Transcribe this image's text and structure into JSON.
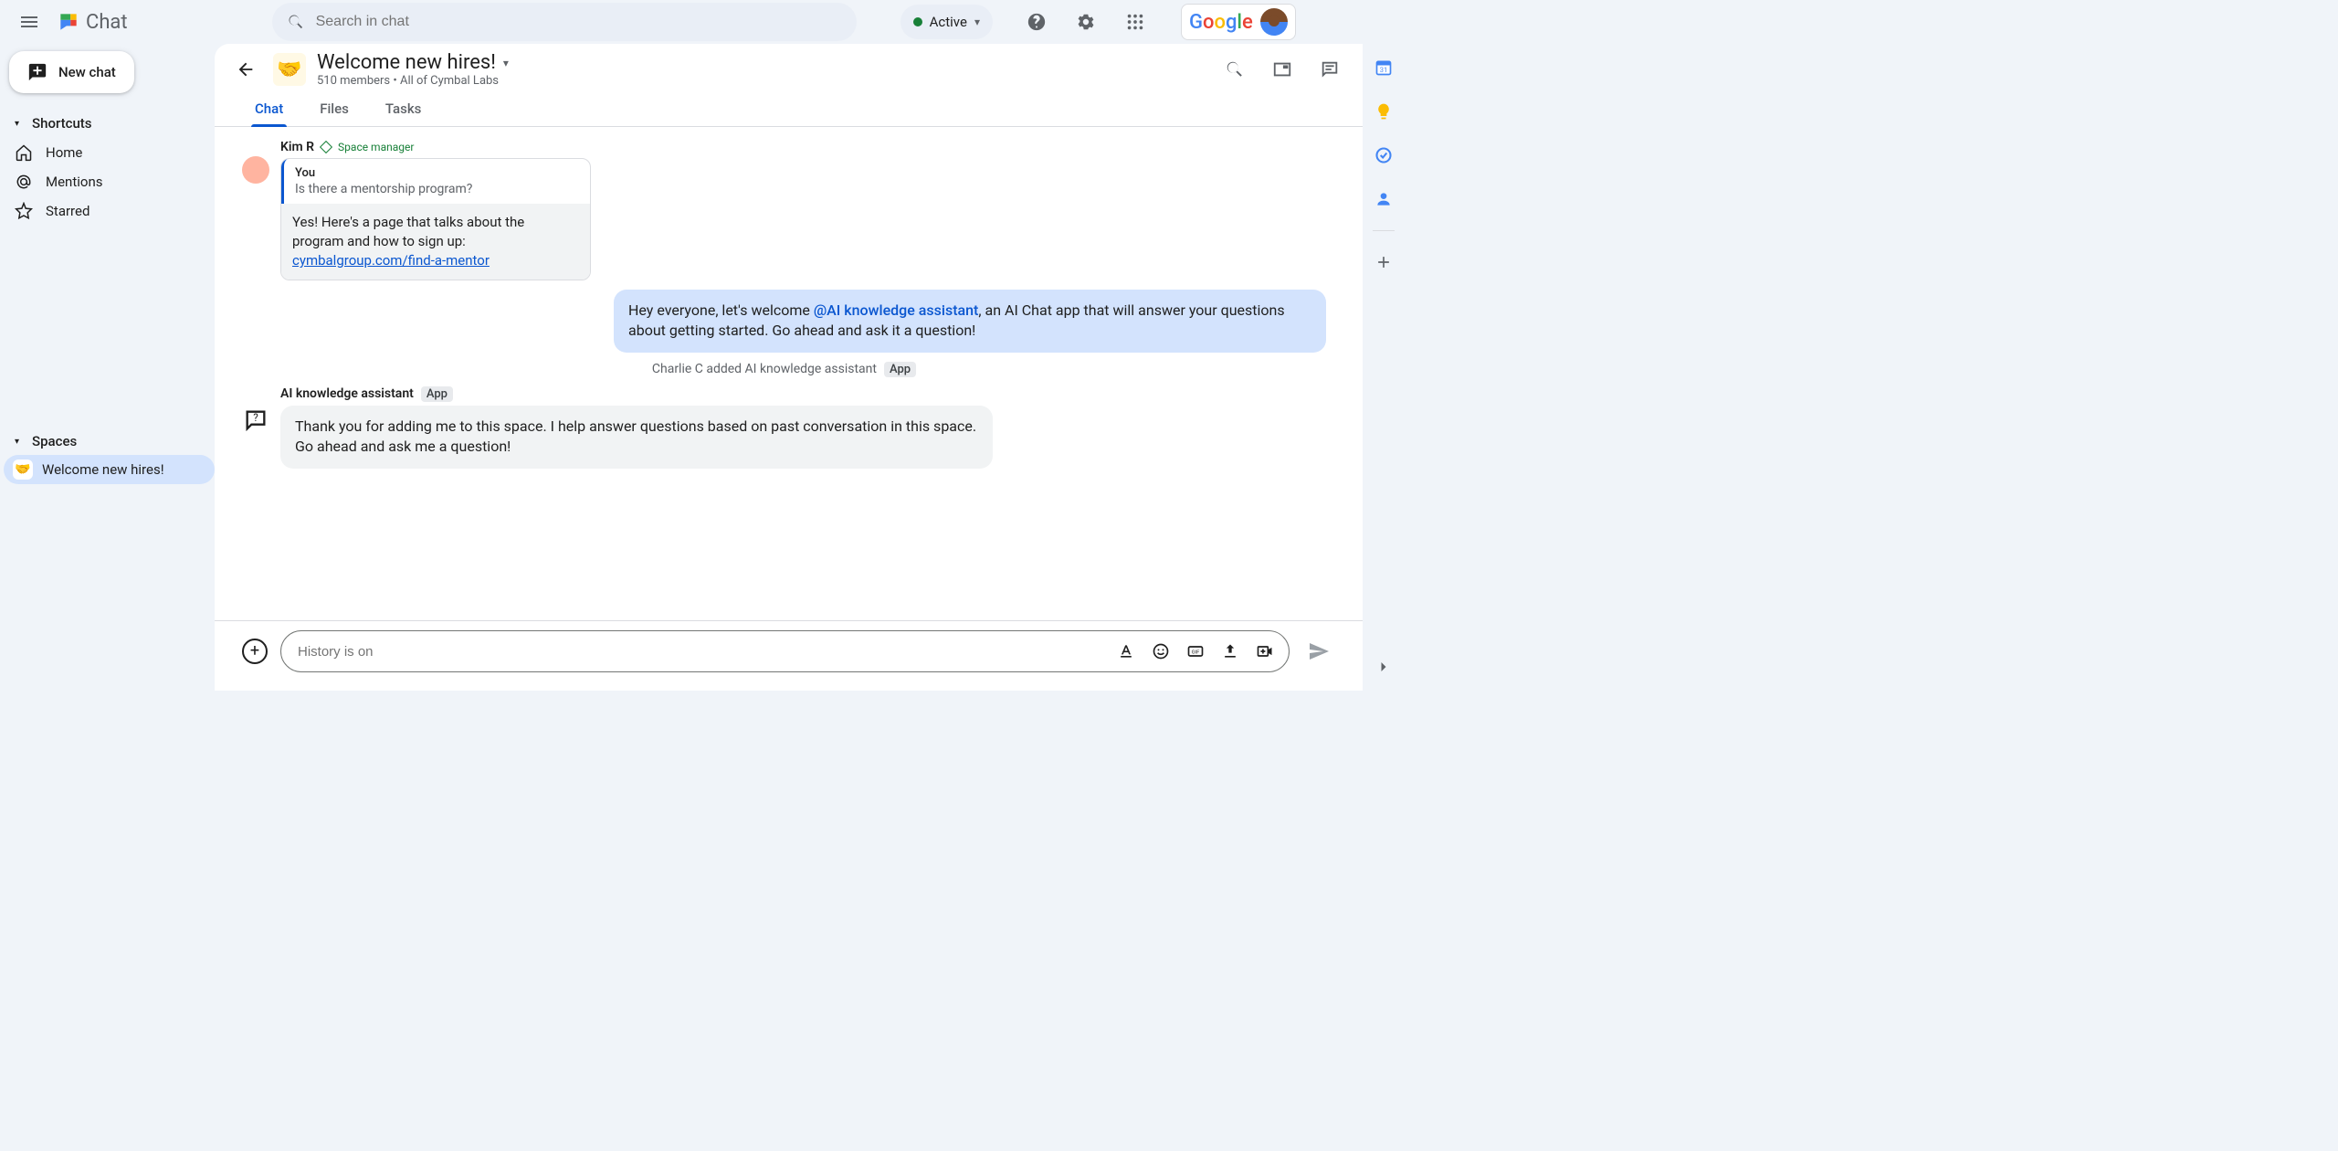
{
  "app_name": "Chat",
  "search": {
    "placeholder": "Search in chat"
  },
  "status": {
    "text": "Active"
  },
  "new_chat_label": "New chat",
  "nav": {
    "shortcuts_label": "Shortcuts",
    "items": [
      {
        "label": "Home"
      },
      {
        "label": "Mentions"
      },
      {
        "label": "Starred"
      }
    ],
    "spaces_label": "Spaces",
    "spaces": [
      {
        "label": "Welcome new hires!",
        "emoji": "🤝"
      }
    ]
  },
  "space": {
    "emoji": "🤝",
    "title": "Welcome new hires!",
    "subtitle": "510 members  •  All of Cymbal Labs",
    "tabs": [
      {
        "label": "Chat"
      },
      {
        "label": "Files"
      },
      {
        "label": "Tasks"
      }
    ]
  },
  "messages": {
    "kim": {
      "name": "Kim R",
      "role": "Space manager",
      "quoted_sender": "You",
      "quoted_text": "Is there a mentorship program?",
      "reply_pre": "Yes! Here's a page that talks about the program and how to sign up: ",
      "reply_link": "cymbalgroup.com/find-a-mentor"
    },
    "self": {
      "pre": "Hey everyone, let's welcome ",
      "mention": "@AI knowledge assistant",
      "post": ", an AI Chat app that will answer your questions about getting started.  Go ahead and ask it a question!"
    },
    "system": {
      "text": "Charlie C added AI knowledge assistant",
      "badge": "App"
    },
    "ai": {
      "name": "AI knowledge assistant",
      "badge": "App",
      "text": "Thank you for adding me to this space. I help answer questions based on past conversation in this space. Go ahead and ask me a question!"
    }
  },
  "compose": {
    "placeholder": "History is on"
  },
  "google_label": "Google"
}
